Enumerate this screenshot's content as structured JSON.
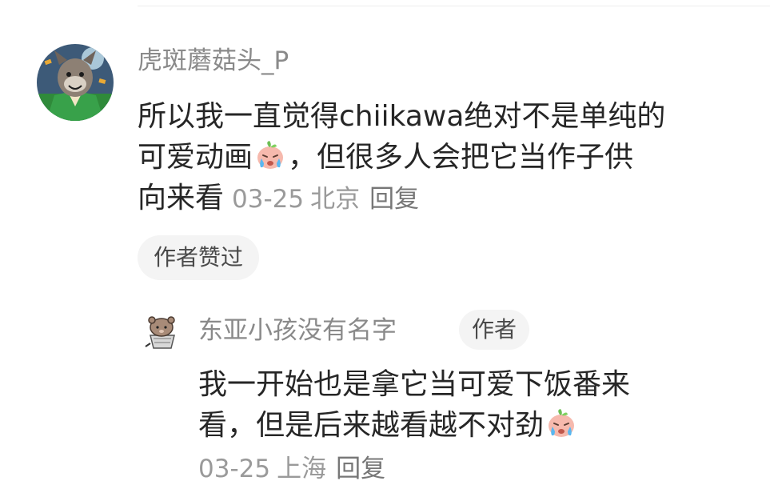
{
  "comment": {
    "username": "虎斑蘑菇头_P",
    "text_lines": [
      "所以我一直觉得chiikawa绝对不是单纯的",
      "可爱动画",
      "，但很多人会把它当作子供",
      "向来看"
    ],
    "time": "03-25",
    "location": "北京",
    "reply_label": "回复",
    "liked_badge": "作者赞过",
    "emoji": "crying-peach-emoji"
  },
  "reply": {
    "username": "东亚小孩没有名字",
    "author_badge": "作者",
    "text_lines": [
      "我一开始也是拿它当可爱下饭番来",
      "看，但是后来越看越不对劲"
    ],
    "time": "03-25",
    "location": "上海",
    "reply_label": "回复",
    "emoji": "crying-peach-emoji"
  }
}
